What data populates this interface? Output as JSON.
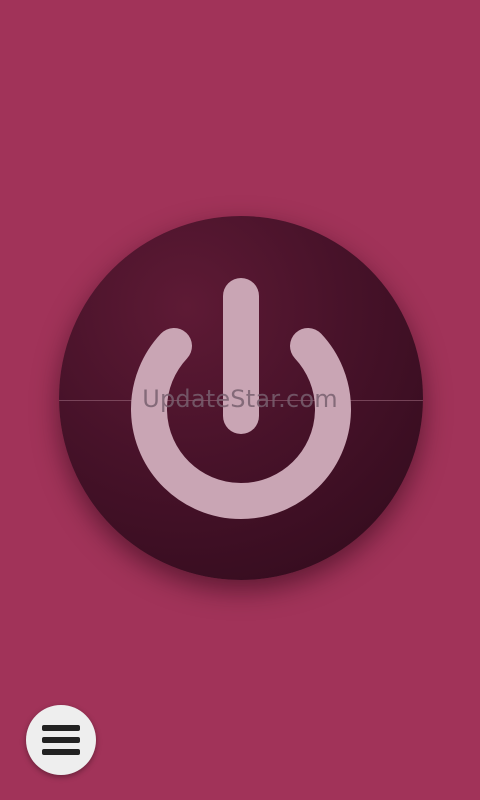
{
  "screen": {
    "background_color": "#a13359"
  },
  "power_button": {
    "icon": "power-icon",
    "disc_color": "#471229",
    "icon_color": "#c9a5b4"
  },
  "watermark": {
    "text": "UpdateStar.com"
  },
  "menu_button": {
    "icon": "hamburger-menu-icon",
    "background_color": "#eeeeee"
  }
}
